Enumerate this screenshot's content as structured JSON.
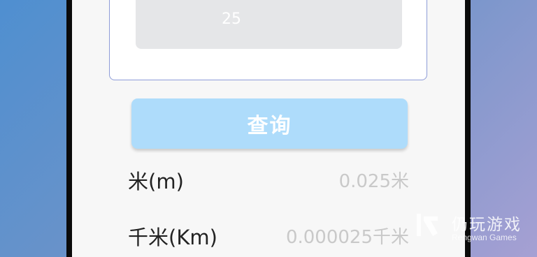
{
  "converter": {
    "input_value": "25",
    "query_label": "查询",
    "results": [
      {
        "label": "米(m)",
        "value": "0.025米"
      },
      {
        "label": "千米(Km)",
        "value": "0.000025千米"
      }
    ]
  },
  "watermark": {
    "name": "仍玩游戏",
    "sub": "Rengwan Games"
  },
  "colors": {
    "button_bg": "#aedcfb",
    "input_bg": "#e5e6e8",
    "card_border": "#8e9cd8",
    "frame": "#0b0b0b"
  }
}
